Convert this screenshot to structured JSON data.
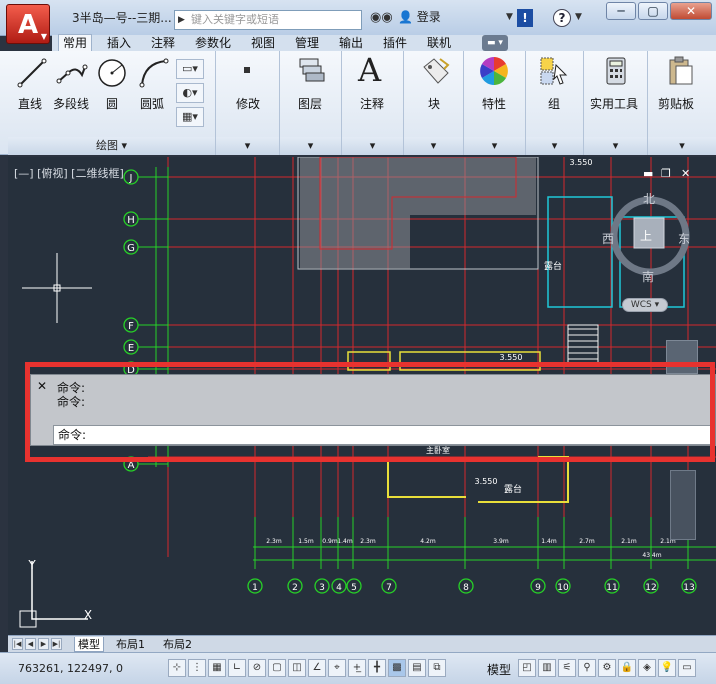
{
  "titlebar": {
    "app_button": "A",
    "title": "3半岛—号--三期...",
    "search_placeholder": "键入关键字或短语",
    "login": "登录",
    "excl": "!",
    "help": "?",
    "minimize": "─",
    "restore": "▢",
    "close": "✕"
  },
  "tabs": [
    "常用",
    "插入",
    "注释",
    "参数化",
    "视图",
    "管理",
    "输出",
    "插件",
    "联机"
  ],
  "ribbon": {
    "draw": {
      "line": "直线",
      "polyline": "多段线",
      "circle": "圆",
      "arc": "圆弧",
      "footer": "绘图"
    },
    "modify": "修改",
    "layers": "图层",
    "annotation": "注释",
    "block": "块",
    "properties": "特性",
    "group": "组",
    "utilities": "实用工具",
    "clipboard": "剪贴板"
  },
  "viewport": {
    "label": "[—] [俯视] [二维线框]",
    "compass": {
      "north": "北",
      "south": "南",
      "west": "西",
      "east": "东",
      "top": "上"
    },
    "wcs": "WCS"
  },
  "drawing": {
    "row_labels": [
      "J",
      "H",
      "G",
      "F",
      "E",
      "D",
      "A"
    ],
    "col_labels": [
      "1",
      "2",
      "3",
      "4",
      "5",
      "7",
      "8",
      "9",
      "10",
      "11",
      "12",
      "13"
    ],
    "level_labels": [
      "3.550",
      "3.550",
      "3.550"
    ],
    "room_labels": [
      "露台",
      "露台",
      "主卧室"
    ],
    "dim_labels": [
      "2.3m",
      "1.5m",
      "0.9m",
      "1.4m",
      "2.3m",
      "4.2m",
      "3.9m",
      "1.4m",
      "2.7m",
      "2.1m",
      "2.1m",
      "43.4m"
    ]
  },
  "command": {
    "history": [
      "命令:",
      "命令:"
    ],
    "prompt": "命令:"
  },
  "layout_tabs": [
    "模型",
    "布局1",
    "布局2"
  ],
  "statusbar": {
    "coords": "763261, 122497, 0",
    "model": "模型"
  },
  "colors": {
    "background": "#26303c",
    "grid_red": "#d4282d",
    "grid_green": "#27d127",
    "cyan": "#1fc7d8",
    "highlight": "#e8322f"
  }
}
